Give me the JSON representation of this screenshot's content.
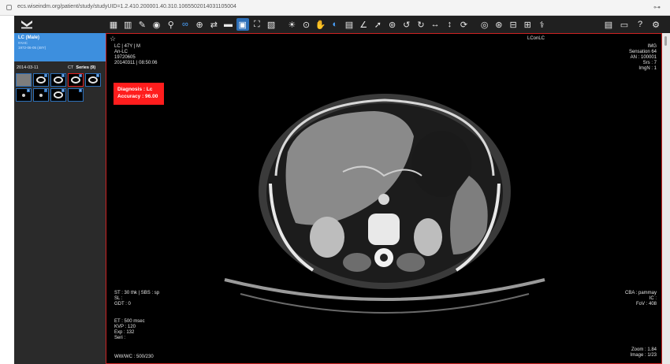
{
  "browser": {
    "url": "ecs.wiseindm.org/patient/study/studyUID=1.2.410.200001.40.310.1065502014031105004",
    "ext_icon": "puzzle-icon"
  },
  "toolbar": {
    "logo_icon": "app-logo-icon",
    "tools": [
      {
        "name": "layout-icon",
        "glyph": "▦"
      },
      {
        "name": "grid-icon",
        "glyph": "▥"
      },
      {
        "name": "brush-icon",
        "glyph": "✎"
      },
      {
        "name": "target-icon",
        "glyph": "◉"
      },
      {
        "name": "magic-wand-icon",
        "glyph": "⚲"
      },
      {
        "name": "link-icon",
        "glyph": "∞",
        "state": "active"
      },
      {
        "name": "crosshair-icon",
        "glyph": "⊕"
      },
      {
        "name": "swap-icon",
        "glyph": "⇄"
      },
      {
        "name": "minus-icon",
        "glyph": "▬"
      },
      {
        "name": "screen-icon",
        "glyph": "▣",
        "state": "boxed"
      },
      {
        "name": "fullscreen-icon",
        "glyph": "⛶"
      },
      {
        "name": "image-icon",
        "glyph": "▧"
      },
      {
        "name": "brightness-icon",
        "glyph": "☀",
        "gap": true
      },
      {
        "name": "zoom-icon",
        "glyph": "⊙"
      },
      {
        "name": "pan-hand-icon",
        "glyph": "✋"
      },
      {
        "name": "invert-icon",
        "glyph": "◐",
        "state": "active"
      },
      {
        "name": "histogram-icon",
        "glyph": "▤"
      },
      {
        "name": "angle-icon",
        "glyph": "∠"
      },
      {
        "name": "pointer-icon",
        "glyph": "➚"
      },
      {
        "name": "roi-icon",
        "glyph": "⊚"
      },
      {
        "name": "rotate-left-icon",
        "glyph": "↺"
      },
      {
        "name": "rotate-right-icon",
        "glyph": "↻"
      },
      {
        "name": "flip-horizontal-icon",
        "glyph": "↔"
      },
      {
        "name": "flip-vertical-icon",
        "glyph": "↕"
      },
      {
        "name": "reset-icon",
        "glyph": "⟳"
      },
      {
        "name": "cine-icon",
        "glyph": "◎",
        "gap": true
      },
      {
        "name": "record-icon",
        "glyph": "⊛"
      },
      {
        "name": "export-icon",
        "glyph": "⊟"
      },
      {
        "name": "save-icon",
        "glyph": "⊞"
      },
      {
        "name": "stethoscope-icon",
        "glyph": "⚕"
      }
    ],
    "right_tools": [
      {
        "name": "report-icon",
        "glyph": "▤"
      },
      {
        "name": "comment-icon",
        "glyph": "▭"
      },
      {
        "name": "help-icon",
        "glyph": "?"
      },
      {
        "name": "user-settings-icon",
        "glyph": "⚙"
      }
    ]
  },
  "sidebar": {
    "patient_name": "LC (Male)",
    "patient_lines": [
      "#AHC",
      "1972-06-05 (48Y)"
    ],
    "study_date": "2014-03-11",
    "series_prefix": "CT",
    "series_label": "Series (9)",
    "thumbnails": [
      {
        "type": "gray",
        "num": ""
      },
      {
        "type": "ring",
        "num": "2"
      },
      {
        "type": "ring",
        "num": "3"
      },
      {
        "type": "ring",
        "num": "4",
        "selected": true
      },
      {
        "type": "ring",
        "num": "5"
      },
      {
        "type": "dot",
        "num": "6"
      },
      {
        "type": "dot",
        "num": "7"
      },
      {
        "type": "ring",
        "num": "8"
      },
      {
        "type": "blank",
        "num": "9"
      }
    ]
  },
  "viewer": {
    "star_icon": "star-icon",
    "top_center": "LConLC",
    "top_left": [
      "LC | 47Y | M",
      "An-LC",
      "19720605",
      "20140311 | 08:50:06"
    ],
    "top_right": [
      "IMG",
      "Sensation 64",
      "AN : 100001",
      "Srs : 7",
      "ImgN : 1"
    ],
    "diagnosis_label": "Diagnosis : Lc",
    "accuracy_label": "Accuracy : 96.00",
    "bottom_left_1": [
      "ST : 30 thk | SBS : sp",
      "SL :",
      "GDT : 0"
    ],
    "bottom_left_2": [
      "ET : 500 msec",
      "KVP : 120",
      "Exp : 132",
      "Seri :"
    ],
    "bottom_left_3": [
      "WW/WC : 500/230"
    ],
    "bottom_right_1": [
      "CBA : pammay",
      "IC :",
      "FoV : 408"
    ],
    "bottom_right_2": [
      "Zoom : 1.84",
      "Image : 1/23"
    ]
  },
  "colors": {
    "accent_blue": "#3d8fde",
    "alert_red": "#ff1d1d",
    "toolbar_bg": "#202020",
    "sidebar_bg": "#2a2a2a"
  }
}
